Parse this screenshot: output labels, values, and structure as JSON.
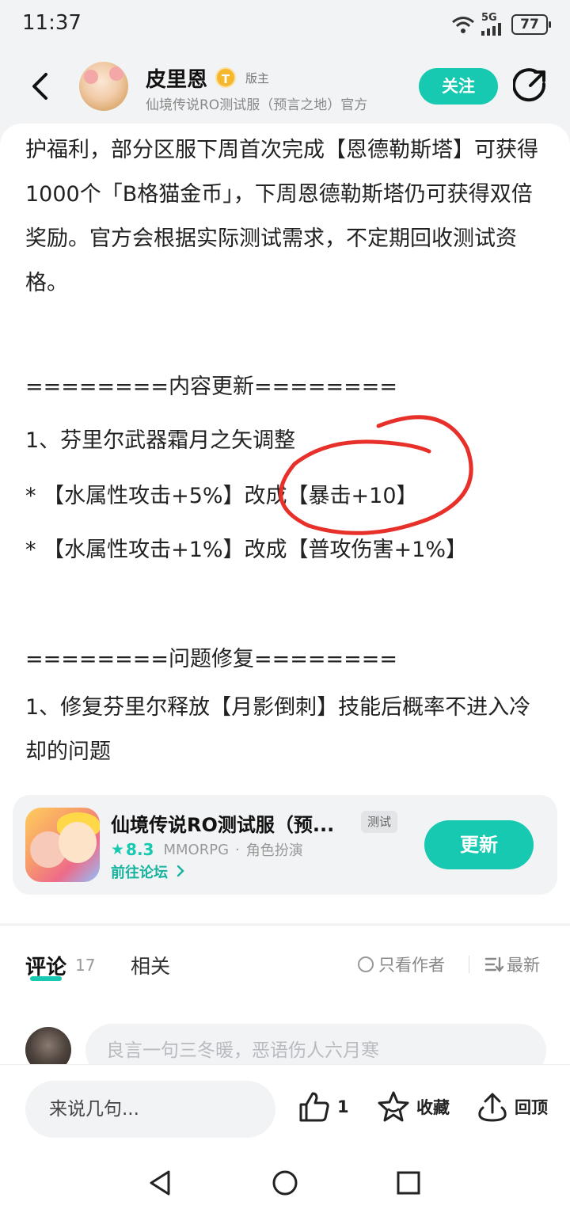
{
  "status": {
    "time": "11:37",
    "network": "5G",
    "battery": "77"
  },
  "header": {
    "author_name": "皮里恩",
    "badge_letter": "T",
    "role": "版主",
    "subtitle": "仙境传说RO测试服（预言之地）官方",
    "follow_label": "关注"
  },
  "post": {
    "intro": "护福利，部分区服下周首次完成【恩德勒斯塔】可获得1000个「B格猫金币」，下周恩德勒斯塔仍可获得双倍奖励。官方会根据实际测试需求，不定期回收测试资格。",
    "section_update": "========内容更新========",
    "update_item": "1、芬里尔武器霜月之矢调整",
    "update_line1": "* 【水属性攻击+5%】改成【暴击+10】",
    "update_line2": "* 【水属性攻击+1%】改成【普攻伤害+1%】",
    "section_fix": "========问题修复========",
    "fix_item": "1、修复芬里尔释放【月影倒刺】技能后概率不进入冷却的问题"
  },
  "app_card": {
    "name": "仙境传说RO测试服（预...",
    "tag": "测试",
    "score": "8.3",
    "genre": "MMORPG",
    "separator": "·",
    "category": "角色扮演",
    "forum_link": "前往论坛",
    "update_label": "更新"
  },
  "comments": {
    "tab_label": "评论",
    "count": "17",
    "related_label": "相关",
    "only_author_label": "只看作者",
    "sort_label": "最新",
    "input_placeholder": "良言一句三冬暖，恶语伤人六月寒"
  },
  "bottom_bar": {
    "say_placeholder": "来说几句...",
    "like_count": "1",
    "favorite_label": "收藏",
    "top_label": "回顶"
  },
  "colors": {
    "accent": "#16c9b0",
    "annotation_red": "#e8302a"
  },
  "icons": [
    "back-arrow-icon",
    "share-icon",
    "star-icon",
    "chevron-right-icon",
    "thumb-up-icon",
    "star-outline-icon",
    "arrow-up-icon",
    "nav-back-icon",
    "nav-home-icon",
    "nav-recents-icon",
    "wifi-icon",
    "signal-icon",
    "battery-icon"
  ]
}
